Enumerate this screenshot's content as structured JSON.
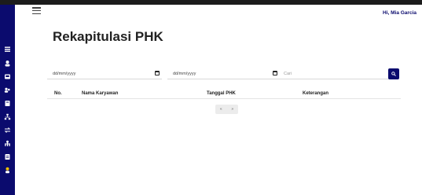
{
  "header": {
    "greeting": "Hi, Mia Garcia"
  },
  "page": {
    "title": "Rekapitulasi PHK"
  },
  "filters": {
    "start_date_placeholder": "dd/mm/yyyy",
    "end_date_placeholder": "dd/mm/yyyy",
    "search_placeholder": "Cari"
  },
  "table": {
    "columns": [
      "No.",
      "Nama Karyawan",
      "Tanggal PHK",
      "Keterangan"
    ],
    "rows": []
  },
  "pagination": {
    "prev": "«",
    "next": "»"
  },
  "sidebar": {
    "icons": [
      "menu-icon",
      "user-icon",
      "inbox-icon",
      "users-icon",
      "book-icon",
      "network-icon",
      "transfer-icon",
      "org-icon",
      "document-icon",
      "person-icon"
    ],
    "active_icon": "person-icon"
  },
  "colors": {
    "sidebar": "#0b0b6e",
    "accent": "#f2c200",
    "greeting": "#0b0b6e",
    "search_button": "#0b0b6e"
  }
}
